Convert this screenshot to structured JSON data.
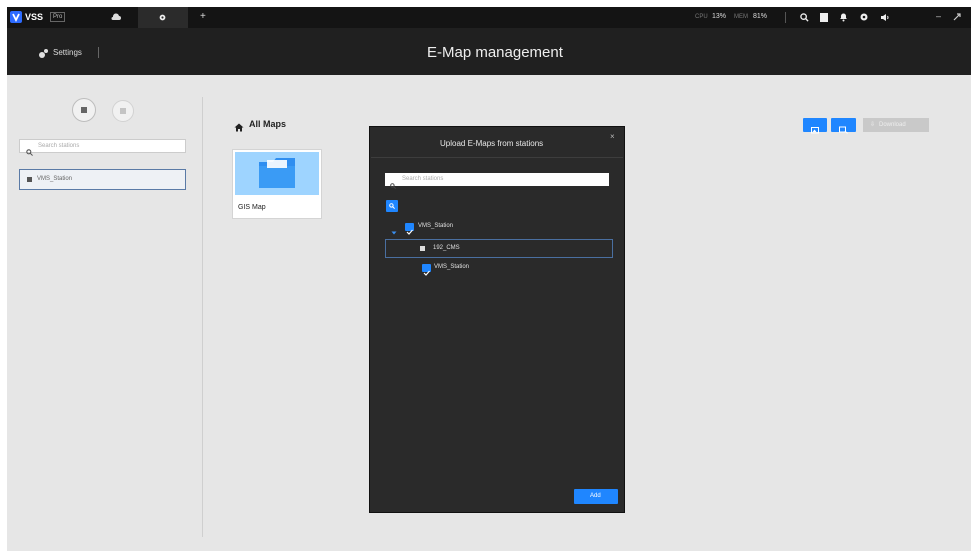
{
  "app": {
    "brand": "VSS",
    "edition": "Pro"
  },
  "topbar": {
    "stat1_label": "CPU",
    "stat1_value": "13%",
    "stat2_label": "MEM",
    "stat2_value": "81%"
  },
  "header": {
    "settings_label": "Settings",
    "title": "E-Map management"
  },
  "sidebar": {
    "search_placeholder": "Search stations",
    "station_label": "VMS_Station"
  },
  "main": {
    "breadcrumb_label": "All Maps",
    "map_card_label": "GIS Map",
    "download_label": "Download"
  },
  "modal": {
    "title": "Upload E-Maps from stations",
    "close_label": "×",
    "search_placeholder": "Search stations",
    "tree": [
      {
        "label": "VMS_Station"
      },
      {
        "label": "192_CMS"
      },
      {
        "label": "VMS_Station"
      }
    ],
    "add_label": "Add"
  },
  "colors": {
    "accent": "#1f86ff",
    "topbar": "#141414",
    "header": "#202020",
    "modal": "#2a2a2a"
  }
}
